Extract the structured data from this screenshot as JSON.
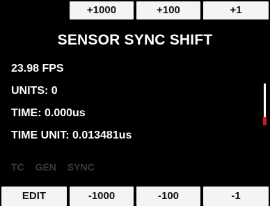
{
  "top_bar": {
    "keys": [
      {
        "label": ""
      },
      {
        "label": "+1000"
      },
      {
        "label": "+100"
      },
      {
        "label": "+1"
      }
    ]
  },
  "menu": {
    "title": "SENSOR SYNC SHIFT",
    "frame_rate": "23.98 FPS",
    "units": "UNITS: 0",
    "time": "TIME: 0.000us",
    "time_unit": "TIME UNIT: 0.013481us"
  },
  "status": {
    "tc": "TC",
    "gen": "GEN",
    "sync": "SYNC"
  },
  "bottom_bar": {
    "keys": [
      {
        "label": "EDIT"
      },
      {
        "label": "-1000"
      },
      {
        "label": "-100"
      },
      {
        "label": "-1"
      }
    ]
  },
  "colors": {
    "background": "#000000",
    "key_fill": "#f4f4f4",
    "key_text": "#111111",
    "status_dim": "#3a3a3a",
    "scroll_marker": "#d21c1c"
  }
}
